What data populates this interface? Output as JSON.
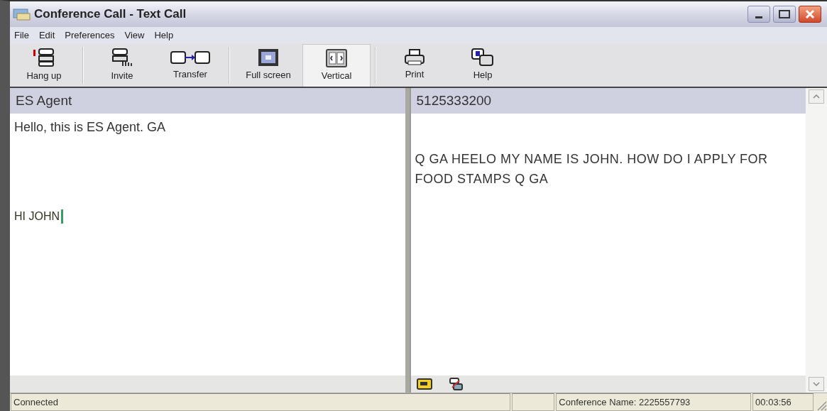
{
  "window": {
    "title": "Conference Call - Text Call"
  },
  "menu": [
    "File",
    "Edit",
    "Preferences",
    "View",
    "Help"
  ],
  "toolbar": [
    {
      "label": "Hang up",
      "selected": false
    },
    {
      "label": "Invite",
      "selected": false
    },
    {
      "label": "Transfer",
      "selected": false
    },
    {
      "label": "Full screen",
      "selected": false
    },
    {
      "label": "Vertical",
      "selected": true
    },
    {
      "label": "Print",
      "selected": false
    },
    {
      "label": "Help",
      "selected": false
    }
  ],
  "panes": [
    {
      "name": "ES Agent",
      "messages": [
        {
          "kind": "received",
          "text": "Hello, this is ES Agent.  GA"
        },
        {
          "kind": "typed",
          "text": "HI JOHN"
        }
      ]
    },
    {
      "name": "5125333200",
      "messages": [
        {
          "kind": "spaced",
          "text": "Q GA  HEELO MY NAME IS JOHN.  HOW DO I APPLY FOR FOOD STAMPS Q GA"
        }
      ]
    }
  ],
  "status_bar": [
    "Connected",
    "Conference Name: 2225557793",
    "00:03:56"
  ]
}
